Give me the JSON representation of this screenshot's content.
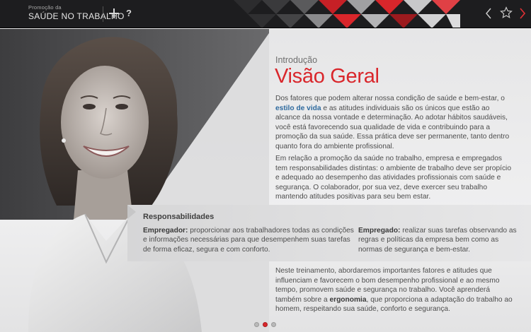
{
  "header": {
    "brand_small": "Promoção da",
    "brand_big": "SAÚDE NO TRABALHO"
  },
  "colors": {
    "accent": "#d9262b",
    "link": "#2e6a9e",
    "topbar": "#1d1d1f"
  },
  "icons": {
    "add": "plus-icon",
    "help": "help-icon",
    "prev": "chevron-left-icon",
    "favorite": "star-icon",
    "next": "chevron-right-icon"
  },
  "content": {
    "section_label": "Introdução",
    "title": "Visão Geral",
    "p1_before": "Dos fatores que podem alterar nossa condição de saúde e bem-estar, o ",
    "p1_highlight": "estilo de vida",
    "p1_after": " e as atitudes individuais são os únicos que estão ao alcance da nossa vontade e determinação. Ao adotar hábitos saudáveis, você está favorecendo sua qualidade de vida e contribuindo para a promoção da sua saúde. Essa prática deve ser permanente, tanto dentro quanto fora do ambiente profissional.",
    "p2": "Em relação a promoção da saúde no trabalho, empresa e empregados tem responsabilidades distintas: o ambiente de trabalho deve ser propício e adequado ao desempenho das atividades profissionais com saúde e segurança. O colaborador, por sua vez, deve exercer seu trabalho mantendo atitudes positivas para seu bem estar.",
    "p4_before": "Neste treinamento, abordaremos importantes fatores e atitudes que influenciam e favorecem o bom desempenho profissional e ao mesmo tempo, promovem saúde e segurança no trabalho. Você aprenderá também sobre a ",
    "p4_bold": "ergonomia",
    "p4_after": ", que proporciona a adaptação do trabalho ao homem, respeitando sua saúde, conforto e segurança."
  },
  "responsibilities": {
    "title": "Responsabilidades",
    "employer_label": "Empregador:",
    "employer_text": " proporcionar aos trabalhadores todas as condições e informações necessárias para que desempenhem suas tarefas de forma eficaz, segura e com conforto.",
    "employee_label": "Empregado:",
    "employee_text": " realizar suas tarefas observando as regras e políticas da empresa bem como as normas de segurança e bem-estar."
  },
  "pager": {
    "total": 3,
    "current": 2
  }
}
